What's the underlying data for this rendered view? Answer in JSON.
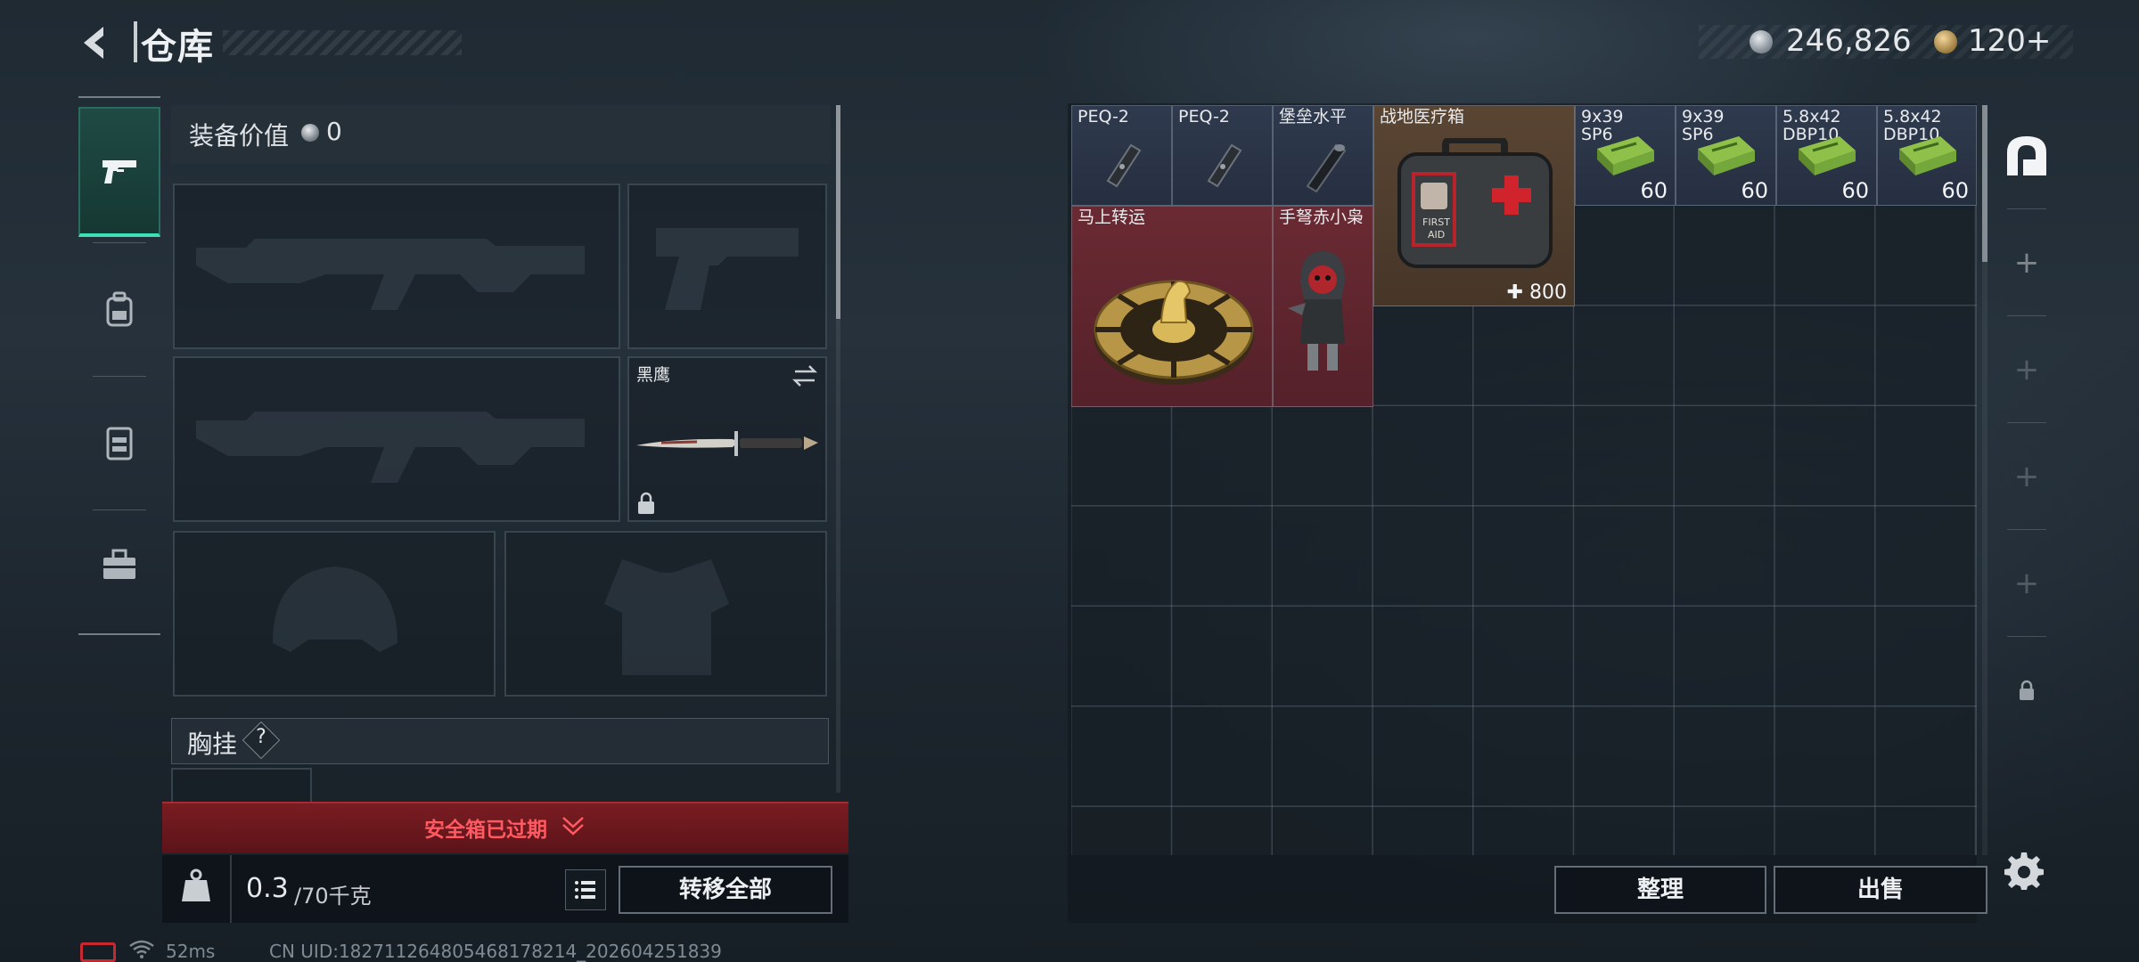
{
  "header": {
    "title": "仓库",
    "silver_amount": "246,826",
    "gold_amount": "120",
    "gold_add": "+"
  },
  "rail": {
    "items": [
      {
        "icon": "pistol-icon",
        "active": true
      },
      {
        "icon": "backpack-icon",
        "active": false
      },
      {
        "icon": "vest-icon",
        "active": false
      },
      {
        "icon": "toolbox-icon",
        "active": false
      }
    ]
  },
  "loadout": {
    "value_label": "装备价值",
    "value_amount": "0",
    "knife_name": "黑鹰",
    "chest_label": "胸挂",
    "chest_help": "?",
    "safebox_status": "安全箱已过期",
    "weight_current": "0.3",
    "weight_max": "/70千克",
    "transfer_all": "转移全部"
  },
  "stash": {
    "items": [
      {
        "name": "PEQ-2",
        "count": "",
        "rarity": "blue",
        "icon": "laser-sight-icon"
      },
      {
        "name": "PEQ-2",
        "count": "",
        "rarity": "blue",
        "icon": "laser-sight-icon"
      },
      {
        "name": "堡垒水平",
        "count": "",
        "rarity": "blue",
        "icon": "scope-icon"
      },
      {
        "name": "战地医疗箱",
        "count": "800",
        "rarity": "brown",
        "icon": "first-aid-kit-icon",
        "icon_text_1": "FIRST",
        "icon_text_2": "AID"
      },
      {
        "name": "9x39\nSP6",
        "count": "60",
        "rarity": "blue",
        "icon": "ammo-box-icon"
      },
      {
        "name": "9x39\nSP6",
        "count": "60",
        "rarity": "blue",
        "icon": "ammo-box-icon"
      },
      {
        "name": "5.8x42\nDBP10",
        "count": "60",
        "rarity": "blue",
        "icon": "ammo-box-icon"
      },
      {
        "name": "5.8x42\nDBP10",
        "count": "60",
        "rarity": "blue",
        "icon": "ammo-box-icon"
      },
      {
        "name": "马上转运",
        "count": "",
        "rarity": "red",
        "icon": "golden-horse-disc-icon"
      },
      {
        "name": "手弩赤小枭",
        "count": "",
        "rarity": "red",
        "icon": "hooded-figure-icon"
      }
    ],
    "sort_label": "整理",
    "sell_label": "出售"
  },
  "status": {
    "ping": "52ms",
    "uid": "CN UID:182711264805468178214_202604251839"
  },
  "colors": {
    "accent": "#3ee0b8",
    "danger": "#ff5a61",
    "rarity_blue": "#2f3a4e",
    "rarity_red": "#6a2a33",
    "rarity_brown": "#5a4533"
  }
}
